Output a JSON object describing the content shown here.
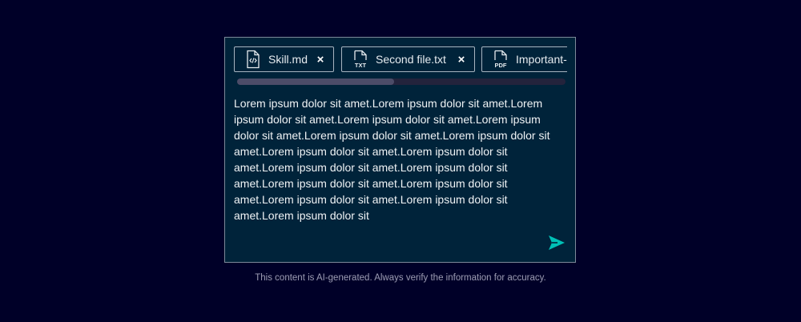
{
  "attachments": [
    {
      "name": "Skill.md",
      "icon": "code-file-icon",
      "close_label": "×"
    },
    {
      "name": "Second file.txt",
      "icon": "txt-file-icon",
      "icon_text": "TXT",
      "close_label": "×"
    },
    {
      "name": "Important-",
      "icon": "pdf-file-icon",
      "icon_text": "PDF"
    }
  ],
  "message": "Lorem ipsum dolor sit amet.Lorem ipsum dolor sit amet.Lorem ipsum dolor sit amet.Lorem ipsum dolor sit amet.Lorem ipsum dolor sit amet.Lorem ipsum dolor sit amet.Lorem ipsum dolor sit amet.Lorem ipsum dolor sit amet.Lorem ipsum dolor sit amet.Lorem ipsum dolor sit amet.Lorem ipsum dolor sit amet.Lorem ipsum dolor sit amet.Lorem ipsum dolor sit amet.Lorem ipsum dolor sit amet.Lorem ipsum dolor sit amet.Lorem ipsum dolor sit",
  "send_icon": "send-icon",
  "disclaimer": "This content is AI-generated. Always verify the information for accuracy.",
  "colors": {
    "background": "#000028",
    "panel": "#00233a",
    "accent": "#00c1b6",
    "text": "#f0f3f5",
    "muted": "#9d9db3"
  }
}
